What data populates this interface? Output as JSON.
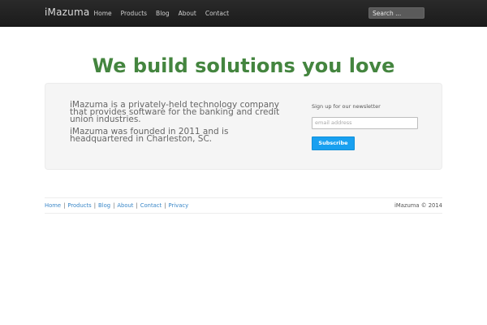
{
  "nav": {
    "brand": "iMazuma",
    "items": [
      {
        "label": "Home"
      },
      {
        "label": "Products"
      },
      {
        "label": "Blog"
      },
      {
        "label": "About"
      },
      {
        "label": "Contact"
      }
    ],
    "search_placeholder": "Search ..."
  },
  "hero": {
    "title": "We build solutions you love"
  },
  "about": {
    "p1": "iMazuma is a privately-held technology company that provides software for the banking and credit union industries.",
    "p2": "iMazuma was founded in 2011 and is headquartered in Charleston, SC."
  },
  "newsletter": {
    "label": "Sign up for our newsletter",
    "email_placeholder": "email address",
    "button": "Subscribe"
  },
  "footer": {
    "links": [
      {
        "label": "Home"
      },
      {
        "label": "Products"
      },
      {
        "label": "Blog"
      },
      {
        "label": "About"
      },
      {
        "label": "Contact"
      },
      {
        "label": "Privacy"
      }
    ],
    "separator": "|",
    "copyright": "iMazuma © 2014"
  },
  "colors": {
    "navbar": "#222222",
    "title_green": "#44853f",
    "button_blue": "#19a0f0",
    "link_blue": "#3a87c8"
  }
}
